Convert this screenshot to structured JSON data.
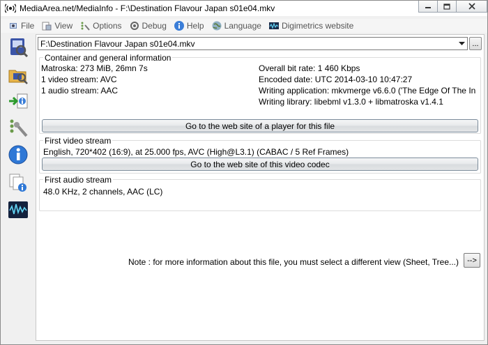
{
  "window": {
    "title": "MediaArea.net/MediaInfo - F:\\Destination Flavour Japan s01e04.mkv"
  },
  "menu": [
    {
      "label": "File",
      "icon": "file-icon"
    },
    {
      "label": "View",
      "icon": "view-icon"
    },
    {
      "label": "Options",
      "icon": "options-icon"
    },
    {
      "label": "Debug",
      "icon": "debug-icon"
    },
    {
      "label": "Help",
      "icon": "help-icon"
    },
    {
      "label": "Language",
      "icon": "language-icon"
    },
    {
      "label": "Digimetrics website",
      "icon": "digimetrics-icon"
    }
  ],
  "toolbar": {
    "tools": [
      "open-file-icon",
      "open-folder-icon",
      "export-icon",
      "preferences-icon",
      "about-icon",
      "knowledge-base-icon",
      "digimetrics-icon"
    ]
  },
  "file_selector": {
    "value": "F:\\Destination Flavour Japan s01e04.mkv",
    "more_label": "..."
  },
  "general": {
    "title": "Container and general information",
    "left": [
      "Matroska: 273 MiB, 26mn 7s",
      "1 video stream: AVC",
      "1 audio stream: AAC"
    ],
    "right": [
      "Overall bit rate: 1 460 Kbps",
      "Encoded date: UTC 2014-03-10 10:47:27",
      "Writing application: mkvmerge v6.6.0 ('The Edge Of The In",
      "Writing library: libebml v1.3.0 + libmatroska v1.4.1"
    ],
    "button": "Go to the web site of a player for this file"
  },
  "video": {
    "title": "First video stream",
    "line": "English, 720*402 (16:9), at 25.000 fps, AVC (High@L3.1) (CABAC / 5 Ref Frames)",
    "button": "Go to the web site of this video codec"
  },
  "audio": {
    "title": "First audio stream",
    "line": "48.0 KHz, 2 channels, AAC (LC)"
  },
  "note": {
    "text": "Note : for more information about this file, you must select a different view (Sheet, Tree...)",
    "button": "-->"
  }
}
